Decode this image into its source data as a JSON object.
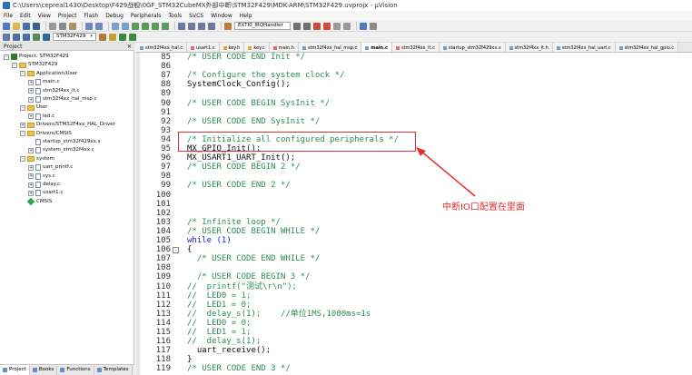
{
  "window": {
    "title": "C:\\Users\\cepreal1430\\Desktop\\F429战舰\\0GF_STM32CubeMX外部中断\\STM32F429\\MDK-ARM\\STM32F429.uvprojx - µVision"
  },
  "menu": [
    "File",
    "Edit",
    "View",
    "Project",
    "Flash",
    "Debug",
    "Peripherals",
    "Tools",
    "SVCS",
    "Window",
    "Help"
  ],
  "toolbar": {
    "search_value": "EXTI0_IRQHandler",
    "target": "STM32F429"
  },
  "project": {
    "header": "Project",
    "tree": [
      {
        "label": "Project: STM32F429",
        "level": 0,
        "type": "root",
        "exp": "-"
      },
      {
        "label": "STM32F429",
        "level": 1,
        "type": "target",
        "exp": "-"
      },
      {
        "label": "Application/User",
        "level": 2,
        "type": "folder",
        "exp": "-"
      },
      {
        "label": "main.c",
        "level": 3,
        "type": "file",
        "exp": "+"
      },
      {
        "label": "stm32f4xx_it.c",
        "level": 3,
        "type": "file",
        "exp": "+"
      },
      {
        "label": "stm32f4xx_hal_msp.c",
        "level": 3,
        "type": "file",
        "exp": "+"
      },
      {
        "label": "User",
        "level": 2,
        "type": "folder",
        "exp": "-"
      },
      {
        "label": "led.c",
        "level": 3,
        "type": "file",
        "exp": "+"
      },
      {
        "label": "Drivers/STM32F4xx_HAL_Driver",
        "level": 2,
        "type": "folder",
        "exp": "+"
      },
      {
        "label": "Drivers/CMSIS",
        "level": 2,
        "type": "folder",
        "exp": "-"
      },
      {
        "label": "startup_stm32f429xx.s",
        "level": 3,
        "type": "file",
        "exp": ""
      },
      {
        "label": "system_stm32f4xx.c",
        "level": 3,
        "type": "file",
        "exp": "+"
      },
      {
        "label": "system",
        "level": 2,
        "type": "folder",
        "exp": "-"
      },
      {
        "label": "uart_printf.c",
        "level": 3,
        "type": "file",
        "exp": "+"
      },
      {
        "label": "sys.c",
        "level": 3,
        "type": "file",
        "exp": "+"
      },
      {
        "label": "delay.c",
        "level": 3,
        "type": "file",
        "exp": "+"
      },
      {
        "label": "usart1.c",
        "level": 3,
        "type": "file",
        "exp": "+"
      },
      {
        "label": "CMSIS",
        "level": 2,
        "type": "cmsis",
        "exp": ""
      }
    ],
    "bottom_tabs": [
      "Project",
      "Books",
      "Functions",
      "Templates"
    ]
  },
  "file_tabs": [
    {
      "label": "stm32f4xx_hal.c",
      "color": "#6aa0d8"
    },
    {
      "label": "usart1.c",
      "color": "#e07070"
    },
    {
      "label": "key.h",
      "color": "#d8a84a"
    },
    {
      "label": "key.c",
      "color": "#d8a84a"
    },
    {
      "label": "main.h",
      "color": "#e07070"
    },
    {
      "label": "stm32f4xx_hal_msp.c",
      "color": "#6aa0d8"
    },
    {
      "label": "main.c",
      "color": "#6aa0d8",
      "active": true
    },
    {
      "label": "stm32f4xx_it.c",
      "color": "#e07070"
    },
    {
      "label": "startup_stm32f429xx.s",
      "color": "#6aa0d8"
    },
    {
      "label": "stm32f4xx_it.h",
      "color": "#6aa0d8"
    },
    {
      "label": "stm32f4xx_hal_uart.c",
      "color": "#6aa0d8"
    },
    {
      "label": "stm32f4xx_hal_gpio.c",
      "color": "#6aa0d8"
    }
  ],
  "code": [
    {
      "n": "85",
      "t": "/* USER CODE END Init */",
      "k": "comment"
    },
    {
      "n": "86",
      "t": "",
      "k": "plain"
    },
    {
      "n": "87",
      "t": "/* Configure the system clock */",
      "k": "comment"
    },
    {
      "n": "88",
      "t": "SystemClock_Config();",
      "k": "plain"
    },
    {
      "n": "89",
      "t": "",
      "k": "plain"
    },
    {
      "n": "90",
      "t": "/* USER CODE BEGIN SysInit */",
      "k": "comment"
    },
    {
      "n": "91",
      "t": "",
      "k": "plain"
    },
    {
      "n": "92",
      "t": "/* USER CODE END SysInit */",
      "k": "comment"
    },
    {
      "n": "93",
      "t": "",
      "k": "plain"
    },
    {
      "n": "94",
      "t": "/* Initialize all configured peripherals */",
      "k": "comment"
    },
    {
      "n": "95",
      "t": "MX_GPIO_Init();",
      "k": "plain"
    },
    {
      "n": "96",
      "t": "MX_USART1_UART_Init();",
      "k": "plain"
    },
    {
      "n": "97",
      "t": "/* USER CODE BEGIN 2 */",
      "k": "comment"
    },
    {
      "n": "98",
      "t": "",
      "k": "plain"
    },
    {
      "n": "99",
      "t": "/* USER CODE END 2 */",
      "k": "comment"
    },
    {
      "n": "100",
      "t": "",
      "k": "plain"
    },
    {
      "n": "101",
      "t": "",
      "k": "plain"
    },
    {
      "n": "102",
      "t": "",
      "k": "plain"
    },
    {
      "n": "103",
      "t": "/* Infinite loop */",
      "k": "comment"
    },
    {
      "n": "104",
      "t": "/* USER CODE BEGIN WHILE */",
      "k": "comment"
    },
    {
      "n": "105",
      "t": "while (1)",
      "k": "kw"
    },
    {
      "n": "106",
      "t": "{",
      "k": "plain",
      "fold": "-"
    },
    {
      "n": "107",
      "t": "  /* USER CODE END WHILE */",
      "k": "comment"
    },
    {
      "n": "108",
      "t": "",
      "k": "plain"
    },
    {
      "n": "109",
      "t": "  /* USER CODE BEGIN 3 */",
      "k": "comment"
    },
    {
      "n": "110",
      "t": "//  printf(\"测试\\r\\n\");",
      "k": "comment"
    },
    {
      "n": "111",
      "t": "//  LED0 = 1;",
      "k": "comment"
    },
    {
      "n": "112",
      "t": "//  LED1 = 0;",
      "k": "comment"
    },
    {
      "n": "113",
      "t": "//  delay_s(1);    //单位1MS,1000ms=1s",
      "k": "comment"
    },
    {
      "n": "114",
      "t": "//  LED0 = 0;",
      "k": "comment"
    },
    {
      "n": "115",
      "t": "//  LED1 = 1;",
      "k": "comment"
    },
    {
      "n": "116",
      "t": "//  delay_s(1);",
      "k": "comment"
    },
    {
      "n": "117",
      "t": "  uart_receive();",
      "k": "plain"
    },
    {
      "n": "118",
      "t": "}",
      "k": "plain"
    },
    {
      "n": "119",
      "t": "/* USER CODE END 3 */",
      "k": "comment"
    }
  ],
  "annotation": {
    "text": "中断IO口配置在里面",
    "color": "#e03030"
  }
}
